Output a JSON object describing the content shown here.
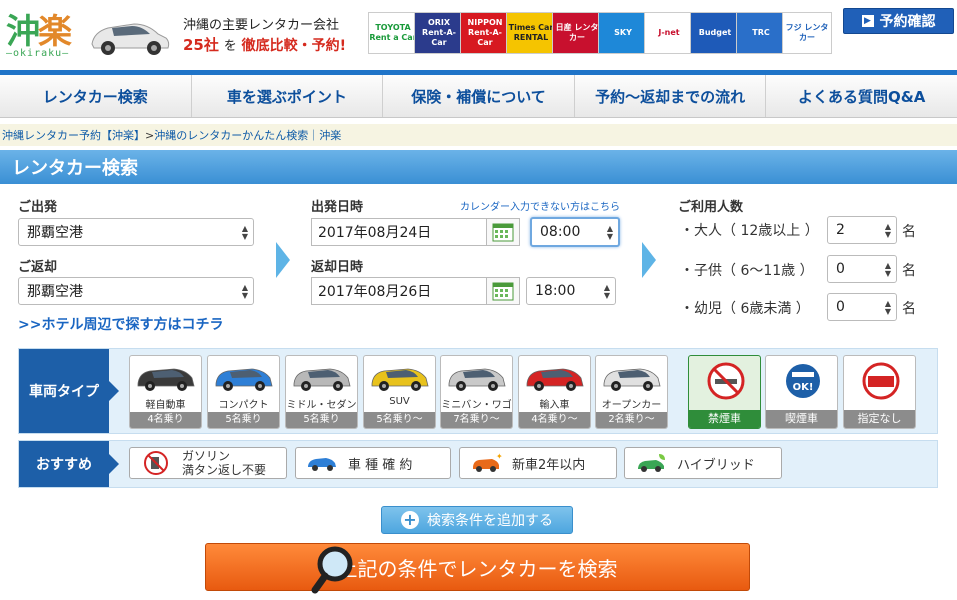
{
  "header": {
    "logo_text_1": "沖",
    "logo_text_2": "楽",
    "logo_sub": "―okiraku―",
    "tagline": "沖縄の主要レンタカー会社",
    "tagline_num": "25社",
    "tagline_mid": "を",
    "tagline_end": "徹底比較・予約!",
    "reserve_label": "予約確認",
    "brands": [
      {
        "name": "TOYOTA Rent a Car",
        "color": "#1a9a3a",
        "bg": "#fff"
      },
      {
        "name": "ORIX Rent-A-Car",
        "color": "#fff",
        "bg": "#2b3b8c"
      },
      {
        "name": "NIPPON Rent-A-Car",
        "color": "#fff",
        "bg": "#d71920"
      },
      {
        "name": "Times Car RENTAL",
        "color": "#222",
        "bg": "#f5c400"
      },
      {
        "name": "日産 レンタカー",
        "color": "#fff",
        "bg": "#c8102e"
      },
      {
        "name": "SKY",
        "color": "#fff",
        "bg": "#1e88d8"
      },
      {
        "name": "J-net",
        "color": "#c8102e",
        "bg": "#fff"
      },
      {
        "name": "Budget",
        "color": "#fff",
        "bg": "#1e5ab8"
      },
      {
        "name": "TRC",
        "color": "#fff",
        "bg": "#2a6fc9"
      },
      {
        "name": "フジ レンタカー",
        "color": "#1a5eb8",
        "bg": "#fff"
      }
    ]
  },
  "nav": {
    "items": [
      "レンタカー検索",
      "車を選ぶポイント",
      "保険・補償について",
      "予約～返却までの流れ",
      "よくある質問Q&A"
    ]
  },
  "breadcrumb": {
    "link1": "沖縄レンタカー予約【沖楽】",
    "sep": " > ",
    "current": "沖縄のレンタカーかんたん検索｜沖楽"
  },
  "section": {
    "title": "レンタカー検索"
  },
  "form": {
    "depart_label": "ご出発",
    "depart_value": "那覇空港",
    "return_label": "ご返却",
    "return_value": "那覇空港",
    "hotel_link": ">>ホテル周辺で探す方はコチラ",
    "depart_dt_label": "出発日時",
    "calendar_link": "カレンダー入力できない方はこちら",
    "depart_date": "2017年08月24日",
    "depart_time": "08:00",
    "return_dt_label": "返却日時",
    "return_date": "2017年08月26日",
    "return_time": "18:00",
    "people_label": "ご利用人数",
    "adult_label": "・大人（ 12歳以上 ）",
    "adult_value": "2",
    "child_label": "・子供（ 6～11歳 ）",
    "child_value": "0",
    "infant_label": "・幼児（ 6歳未満 ）",
    "infant_value": "0",
    "unit": "名"
  },
  "car_types": {
    "label": "車両タイプ",
    "cards": [
      {
        "name": "軽自動車",
        "seats": "4名乗り",
        "color": "#3a3a3a"
      },
      {
        "name": "コンパクト",
        "seats": "5名乗り",
        "color": "#2e7fd6"
      },
      {
        "name": "ミドル・セダン",
        "seats": "5名乗り",
        "color": "#b8b8b8"
      },
      {
        "name": "SUV",
        "seats": "5名乗り～",
        "color": "#e8c21c"
      },
      {
        "name": "ミニバン・ワゴン",
        "seats": "7名乗り～",
        "color": "#c9c9c9"
      },
      {
        "name": "輸入車",
        "seats": "4名乗り～",
        "color": "#d42424"
      },
      {
        "name": "オープンカー",
        "seats": "2名乗り～",
        "color": "#e0e0e0"
      }
    ],
    "smoke": [
      {
        "name": "禁煙車",
        "active": true
      },
      {
        "name": "喫煙車",
        "active": false
      },
      {
        "name": "指定なし",
        "active": false
      }
    ]
  },
  "recommend": {
    "label": "おすすめ",
    "buttons": [
      "ガソリン\n満タン返し不要",
      "車 種 確 約",
      "新車2年以内",
      "ハイブリッド"
    ]
  },
  "actions": {
    "add_condition": "検索条件を追加する",
    "search": "上記の条件でレンタカーを検索"
  }
}
